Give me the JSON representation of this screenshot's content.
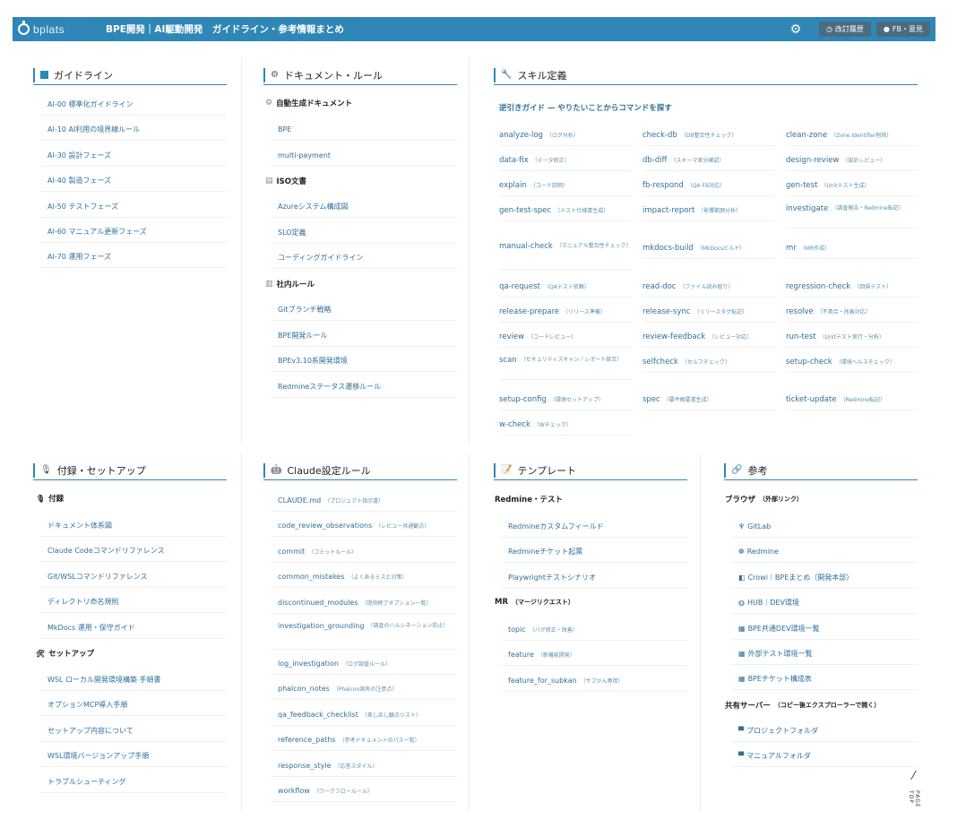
{
  "header": {
    "logo": "bplats",
    "title": "BPE開発｜AI駆動開発　ガイドライン・参考情報まとめ",
    "history_label": "改訂履歴",
    "feedback_label": "FB・意見"
  },
  "guideline": {
    "title": "ガイドライン",
    "items": [
      "AI-00 標準化ガイドライン",
      "AI-10 AI利用の境界線ルール",
      "AI-30 設計フェーズ",
      "AI-40 製造フェーズ",
      "AI-50 テストフェーズ",
      "AI-60 マニュアル更新フェーズ",
      "AI-70 運用フェーズ"
    ]
  },
  "docs": {
    "title": "ドキュメント・ルール",
    "sections": [
      {
        "title": "自動生成ドキュメント",
        "icon": "gear-icon",
        "items": [
          "BPE",
          "multi-payment"
        ]
      },
      {
        "title": "ISO文書",
        "icon": "document-icon",
        "items": [
          "Azureシステム構成図",
          "SLO定義",
          "コーディングガイドライン"
        ]
      },
      {
        "title": "社内ルール",
        "icon": "building-icon",
        "items": [
          "Gitブランチ戦略",
          "BPE開発ルール",
          "BPEv3.10系開発環境",
          "Redmineステータス遷移ルール"
        ]
      }
    ]
  },
  "skills": {
    "title": "スキル定義",
    "guide": "逆引きガイド — やりたいことからコマンドを探す",
    "items": [
      {
        "name": "analyze-log",
        "desc": "（ログ分析）"
      },
      {
        "name": "check-db",
        "desc": "（DB整合性チェック）"
      },
      {
        "name": "clean-zone",
        "desc": "（Zone.Identifier削除）"
      },
      {
        "name": "data-fix",
        "desc": "（データ修正）"
      },
      {
        "name": "db-diff",
        "desc": "（スキーマ差分確認）"
      },
      {
        "name": "design-review",
        "desc": "（設計レビュー）"
      },
      {
        "name": "explain",
        "desc": "（コード説明）"
      },
      {
        "name": "fb-respond",
        "desc": "（QA FB対応）"
      },
      {
        "name": "gen-test",
        "desc": "（Unitテスト生成）"
      },
      {
        "name": "gen-test-spec",
        "desc": "（テスト仕様書生成）"
      },
      {
        "name": "impact-report",
        "desc": "（影響範囲分析）"
      },
      {
        "name": "investigate",
        "desc": "（調査報告・Redmine転記）"
      },
      {
        "name": "manual-check",
        "desc": "（マニュアル整合性チェック）"
      },
      {
        "name": "mkdocs-build",
        "desc": "（MkDocsビルド）"
      },
      {
        "name": "mr",
        "desc": "（MR作成）"
      },
      {
        "name": "qa-request",
        "desc": "（QAテスト依頼）"
      },
      {
        "name": "read-doc",
        "desc": "（ファイル読み取り）"
      },
      {
        "name": "regression-check",
        "desc": "（回帰テスト）"
      },
      {
        "name": "release-prepare",
        "desc": "（リリース準備）"
      },
      {
        "name": "release-sync",
        "desc": "（リリースタグ転記）"
      },
      {
        "name": "resolve",
        "desc": "（不具合・改善対応）"
      },
      {
        "name": "review",
        "desc": "（コードレビュー）"
      },
      {
        "name": "review-feedback",
        "desc": "（レビュー対応）"
      },
      {
        "name": "run-test",
        "desc": "（Unitテスト実行・分析）"
      },
      {
        "name": "scan",
        "desc": "（セキュリティスキャン／レポート統合）"
      },
      {
        "name": "selfcheck",
        "desc": "（セルフチェック）"
      },
      {
        "name": "setup-check",
        "desc": "（環境ヘルスチェック）"
      },
      {
        "name": "setup-config",
        "desc": "（環境セットアップ）"
      },
      {
        "name": "spec",
        "desc": "（要件概要書生成）"
      },
      {
        "name": "ticket-update",
        "desc": "（Redmine転記）"
      },
      {
        "name": "w-check",
        "desc": "（Wチェック）"
      }
    ]
  },
  "appendix": {
    "title": "付録・セットアップ",
    "sec1": "付録",
    "items1": [
      "ドキュメント体系図",
      "Claude Codeコマンドリファレンス",
      "Git/WSLコマンドリファレンス",
      "ディレクトリ命名規則",
      "MkDocs 運用・保守ガイド"
    ],
    "sec2": "セットアップ",
    "items2": [
      "WSL ローカル開発環境構築 手順書",
      "オプションMCP導入手順",
      "セットアップ内容について",
      "WSL環境バージョンアップ手順",
      "トラブルシューティング"
    ]
  },
  "claude": {
    "title": "Claude設定ルール",
    "items": [
      {
        "name": "CLAUDE.md",
        "desc": "（プロジェクト指示書）"
      },
      {
        "name": "code_review_observations",
        "desc": "（レビュー共通観点）"
      },
      {
        "name": "commit",
        "desc": "（コミットルール）"
      },
      {
        "name": "common_mistakes",
        "desc": "（よくあるミスと対策）"
      },
      {
        "name": "discontinued_modules",
        "desc": "（提供終了オプション一覧）"
      },
      {
        "name": "investigation_grounding",
        "desc": "（調査のハルシネーション防止）"
      },
      {
        "name": "log_investigation",
        "desc": "（ログ調査ルール）"
      },
      {
        "name": "phalcon_notes",
        "desc": "（Phalcon固有の注意点）"
      },
      {
        "name": "qa_feedback_checklist",
        "desc": "（差し戻し観点リスト）"
      },
      {
        "name": "reference_paths",
        "desc": "（参考ドキュメントのパス一覧）"
      },
      {
        "name": "response_style",
        "desc": "（応答スタイル）"
      },
      {
        "name": "workflow",
        "desc": "（ワークフロールール）"
      }
    ]
  },
  "template": {
    "title": "テンプレート",
    "sec1": "Redmine・テスト",
    "items1": [
      "Redmineカスタムフィールド",
      "Redmineチケット起票",
      "Playwrightテストシナリオ"
    ],
    "sec2": "MR",
    "sec2_sub": "（マージリクエスト）",
    "items2": [
      {
        "name": "topic",
        "desc": "（バグ修正・改善）"
      },
      {
        "name": "feature",
        "desc": "（新機能開発）"
      },
      {
        "name": "feature_for_subkan",
        "desc": "（サブかん専用）"
      }
    ]
  },
  "reference": {
    "title": "参考",
    "sec1": "ブラウザ",
    "sec1_sub": "（外部リンク）",
    "items1": [
      {
        "label": "GitLab",
        "icon": "gitlab-icon"
      },
      {
        "label": "Redmine",
        "icon": "redmine-icon"
      },
      {
        "label": "Crowi｜BPEまとめ（開発本部）",
        "icon": "crowi-icon"
      },
      {
        "label": "HUB｜DEV環境",
        "icon": "globe-icon"
      },
      {
        "label": "BPE共通DEV環境一覧",
        "icon": "table-icon"
      },
      {
        "label": "外部テスト環境一覧",
        "icon": "table-icon"
      },
      {
        "label": "BPEチケット構成表",
        "icon": "table-icon"
      }
    ],
    "sec2": "共有サーバー",
    "sec2_sub": "（コピー後エクスプローラーで開く）",
    "items2": [
      {
        "label": "プロジェクトフォルダ",
        "icon": "folder-icon"
      },
      {
        "label": "マニュアルフォルダ",
        "icon": "folder-icon"
      }
    ]
  },
  "pagetop": "PAGE TOP"
}
